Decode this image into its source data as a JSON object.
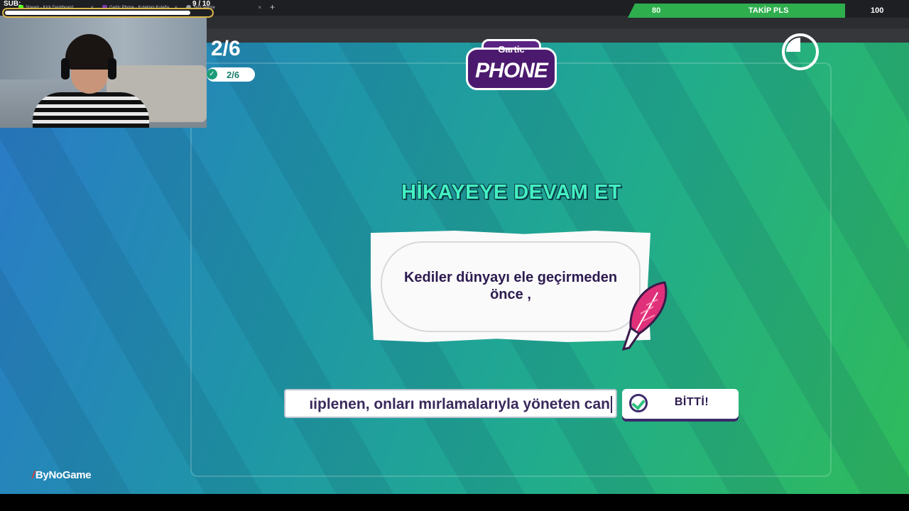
{
  "browser": {
    "tabs": [
      {
        "label": "Stream - Kick Dashboard",
        "color": "#53fc18"
      },
      {
        "label": "Gartic Phone - Kulaktan Kulağa",
        "color": "#7a3aa8"
      },
      {
        "label": "Yeni sekme",
        "color": "#9aa0a6"
      }
    ],
    "new_tab": "+"
  },
  "stream_overlay": {
    "sub_label": "SUB:",
    "sub_goal": "9 / 10",
    "sub_progress": 0.9,
    "follow_goal": {
      "left": "80",
      "label": "TAKİP PLS",
      "right": "100"
    },
    "sponsor": "ByNoGame"
  },
  "game": {
    "round": "2/6",
    "done_count": "2/6",
    "logo_top": "Gartic",
    "logo_bottom": "PHONE",
    "heading": "HİKAYEYE DEVAM ET",
    "prompt": "Kediler dünyayı ele geçirmeden önce ,",
    "input_value": "ıiplenen, onları mırlamalarıyla yöneten can",
    "done_button": "BİTTİ!",
    "colors": {
      "accent": "#44f0c2",
      "ink": "#2c1b4f",
      "quill": "#e0307a"
    }
  }
}
